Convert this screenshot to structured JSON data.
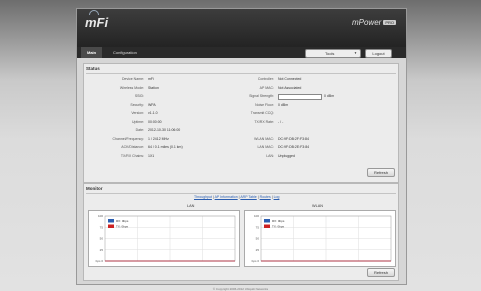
{
  "header": {
    "logo": "mFi",
    "brand": "mPower",
    "brand_badge": "PRO"
  },
  "nav": {
    "tabs": [
      {
        "label": "Main",
        "active": true
      },
      {
        "label": "Configuration",
        "active": false
      }
    ]
  },
  "tools": {
    "label": "Tools",
    "arrow": "▼"
  },
  "logout_label": "Logout",
  "status": {
    "title": "Status",
    "left": [
      {
        "k": "Device Name:",
        "v": "mFi"
      },
      {
        "k": "Wireless Mode:",
        "v": "Station"
      },
      {
        "k": "SSID:",
        "v": ""
      },
      {
        "k": "Security:",
        "v": "WPA"
      },
      {
        "k": "Version:",
        "v": "v1.1.0"
      },
      {
        "k": "Uptime:",
        "v": "00:00:00"
      },
      {
        "k": "Date:",
        "v": "2012-10-30 11:06:00"
      },
      {
        "k": "Channel/Frequency:",
        "v": "1 / 2412 MHz"
      },
      {
        "k": "ACK/Distance:",
        "v": "64 / 0.1 miles (0.1 km)"
      },
      {
        "k": "TX/RX Chains:",
        "v": "1X1"
      }
    ],
    "right": [
      {
        "k": "Controller:",
        "v": "Not Connected"
      },
      {
        "k": "AP MAC:",
        "v": "Not Associated"
      },
      {
        "k": "Signal Strength:",
        "v": "0 dBm",
        "bar": true
      },
      {
        "k": "Noise Floor:",
        "v": "0 dBm"
      },
      {
        "k": "Transmit CCQ:",
        "v": ""
      },
      {
        "k": "TX/RX Rate:",
        "v": "- / -"
      },
      {
        "k": "",
        "v": ""
      },
      {
        "k": "WLAN MAC:",
        "v": "DC:9F:DB:2F:F3:84"
      },
      {
        "k": "LAN MAC:",
        "v": "DC:9F:DB:2E:F3:84"
      },
      {
        "k": "LAN:",
        "v": "Unplugged"
      }
    ],
    "refresh_label": "Refresh"
  },
  "monitor": {
    "title": "Monitor",
    "links": [
      "Throughput",
      "AP Information",
      "ARP Table",
      "Routes",
      "Log"
    ],
    "separator": " | ",
    "refresh_label": "Refresh"
  },
  "chart_data": [
    {
      "type": "line",
      "title": "LAN",
      "y_ticks": [
        "100",
        "75",
        "50",
        "25",
        "bps 0"
      ],
      "ylim": [
        0,
        100
      ],
      "grid": true,
      "legend_placement": "top-left",
      "series": [
        {
          "name": "RX: 0bps",
          "color": "#2a5db0",
          "values": [
            0,
            0,
            0,
            0,
            0,
            0,
            0,
            0
          ]
        },
        {
          "name": "TX: 0bps",
          "color": "#cc2222",
          "values": [
            0,
            0,
            0,
            0,
            0,
            0,
            0,
            0
          ]
        }
      ]
    },
    {
      "type": "line",
      "title": "WLAN",
      "y_ticks": [
        "100",
        "75",
        "50",
        "25",
        "bps 0"
      ],
      "ylim": [
        0,
        100
      ],
      "grid": true,
      "legend_placement": "top-left",
      "series": [
        {
          "name": "RX: 0bps",
          "color": "#2a5db0",
          "values": [
            0,
            0,
            0,
            0,
            0,
            0,
            0,
            0
          ]
        },
        {
          "name": "TX: 0bps",
          "color": "#cc2222",
          "values": [
            0,
            0,
            0,
            0,
            0,
            0,
            0,
            0
          ]
        }
      ]
    }
  ],
  "footer": "© Copyright 2006-2012 Ubiquiti Networks"
}
